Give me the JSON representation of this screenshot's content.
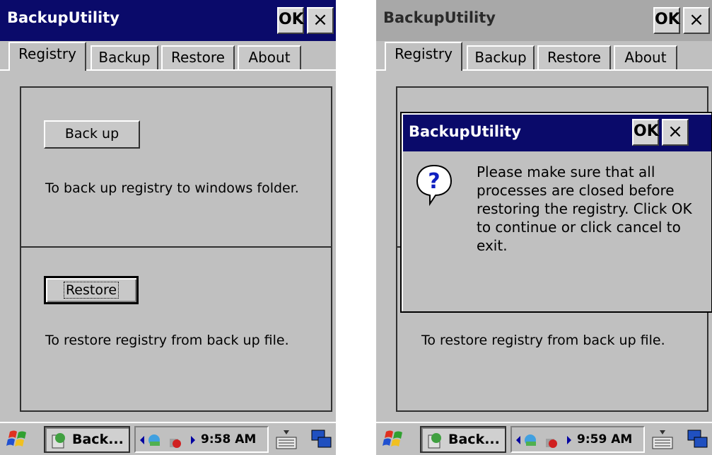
{
  "left_screen": {
    "window_title": "BackupUtility",
    "title_ok": "OK",
    "title_close": "×",
    "tabs": [
      "Registry",
      "Backup",
      "Restore",
      "About"
    ],
    "backup_button": "Back up",
    "backup_desc": "To back up registry to windows folder.",
    "restore_button": "Restore",
    "restore_desc": "To restore registry from back up file.",
    "taskbar_task": "Back...",
    "clock": "9:58 AM"
  },
  "right_screen": {
    "window_title": "BackupUtility",
    "title_ok": "OK",
    "title_close": "×",
    "tabs": [
      "Registry",
      "Backup",
      "Restore",
      "About"
    ],
    "restore_desc": "To restore registry from back up file.",
    "taskbar_task": "Back...",
    "clock": "9:59 AM",
    "dialog": {
      "title": "BackupUtility",
      "ok": "OK",
      "close": "×",
      "message": "Please make sure that all processes are closed before restoring the registry. Click OK to continue or click cancel to exit.",
      "icon": "question-icon"
    }
  },
  "colors": {
    "titlebar_active": "#0a0a6a",
    "titlebar_inactive": "#a8a8a8",
    "face": "#c0c0c0"
  }
}
